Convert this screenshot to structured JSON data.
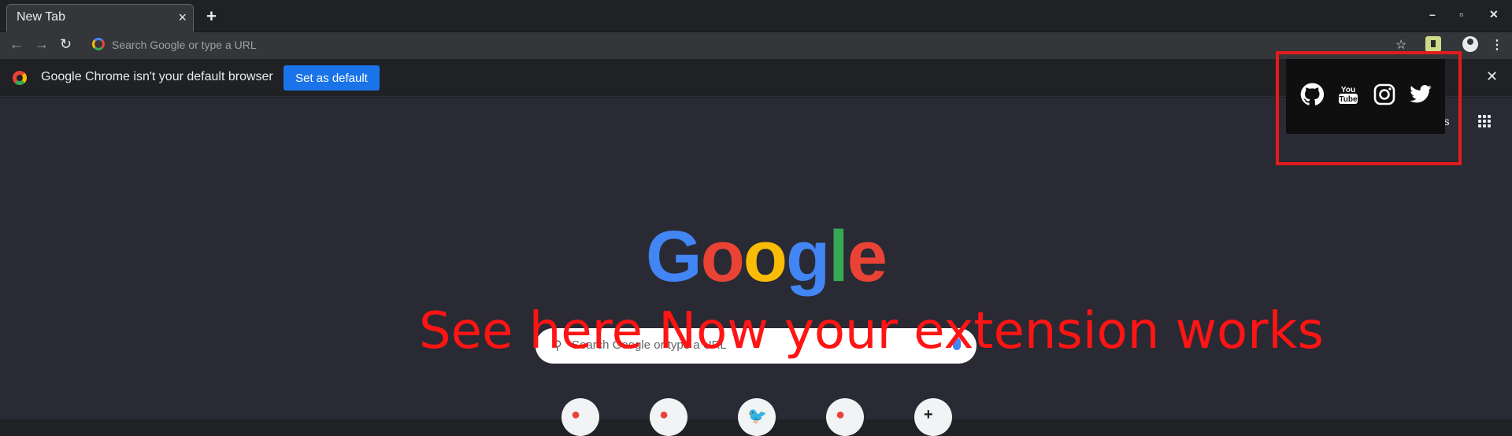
{
  "window": {
    "tab_title": "New Tab",
    "tab_close": "×",
    "new_tab": "+",
    "minimize": "–",
    "maximize": "▫",
    "close": "✕"
  },
  "toolbar": {
    "back": "←",
    "forward": "→",
    "reload": "↻",
    "omnibox_placeholder": "Search Google or type a URL",
    "star": "☆",
    "menu": "⋮"
  },
  "infobar": {
    "message": "Google Chrome isn't your default browser",
    "button_label": "Set as default",
    "close": "✕"
  },
  "ntp": {
    "images_label": "ges",
    "logo_letters": [
      "G",
      "o",
      "o",
      "g",
      "l",
      "e"
    ],
    "logo_colors": [
      "#4285f4",
      "#ea4335",
      "#fbbc05",
      "#4285f4",
      "#34a853",
      "#ea4335"
    ],
    "search_placeholder": "Search Google or type a URL",
    "shortcuts": [
      {
        "icon": "chrome-icon",
        "glyph": "●",
        "color": "#ea4335"
      },
      {
        "icon": "chrome-icon",
        "glyph": "●",
        "color": "#ea4335"
      },
      {
        "icon": "twitter-icon",
        "glyph": "🐦",
        "color": "#1da1f2"
      },
      {
        "icon": "site-icon",
        "glyph": "●",
        "color": "#ea4335"
      },
      {
        "icon": "add-icon",
        "glyph": "+",
        "color": "#202124"
      }
    ]
  },
  "extension_popup": {
    "icons": [
      "github-icon",
      "youtube-icon",
      "instagram-icon",
      "twitter-icon"
    ]
  },
  "annotation": {
    "text": "See here Now your extension works",
    "color": "#ff1414"
  }
}
